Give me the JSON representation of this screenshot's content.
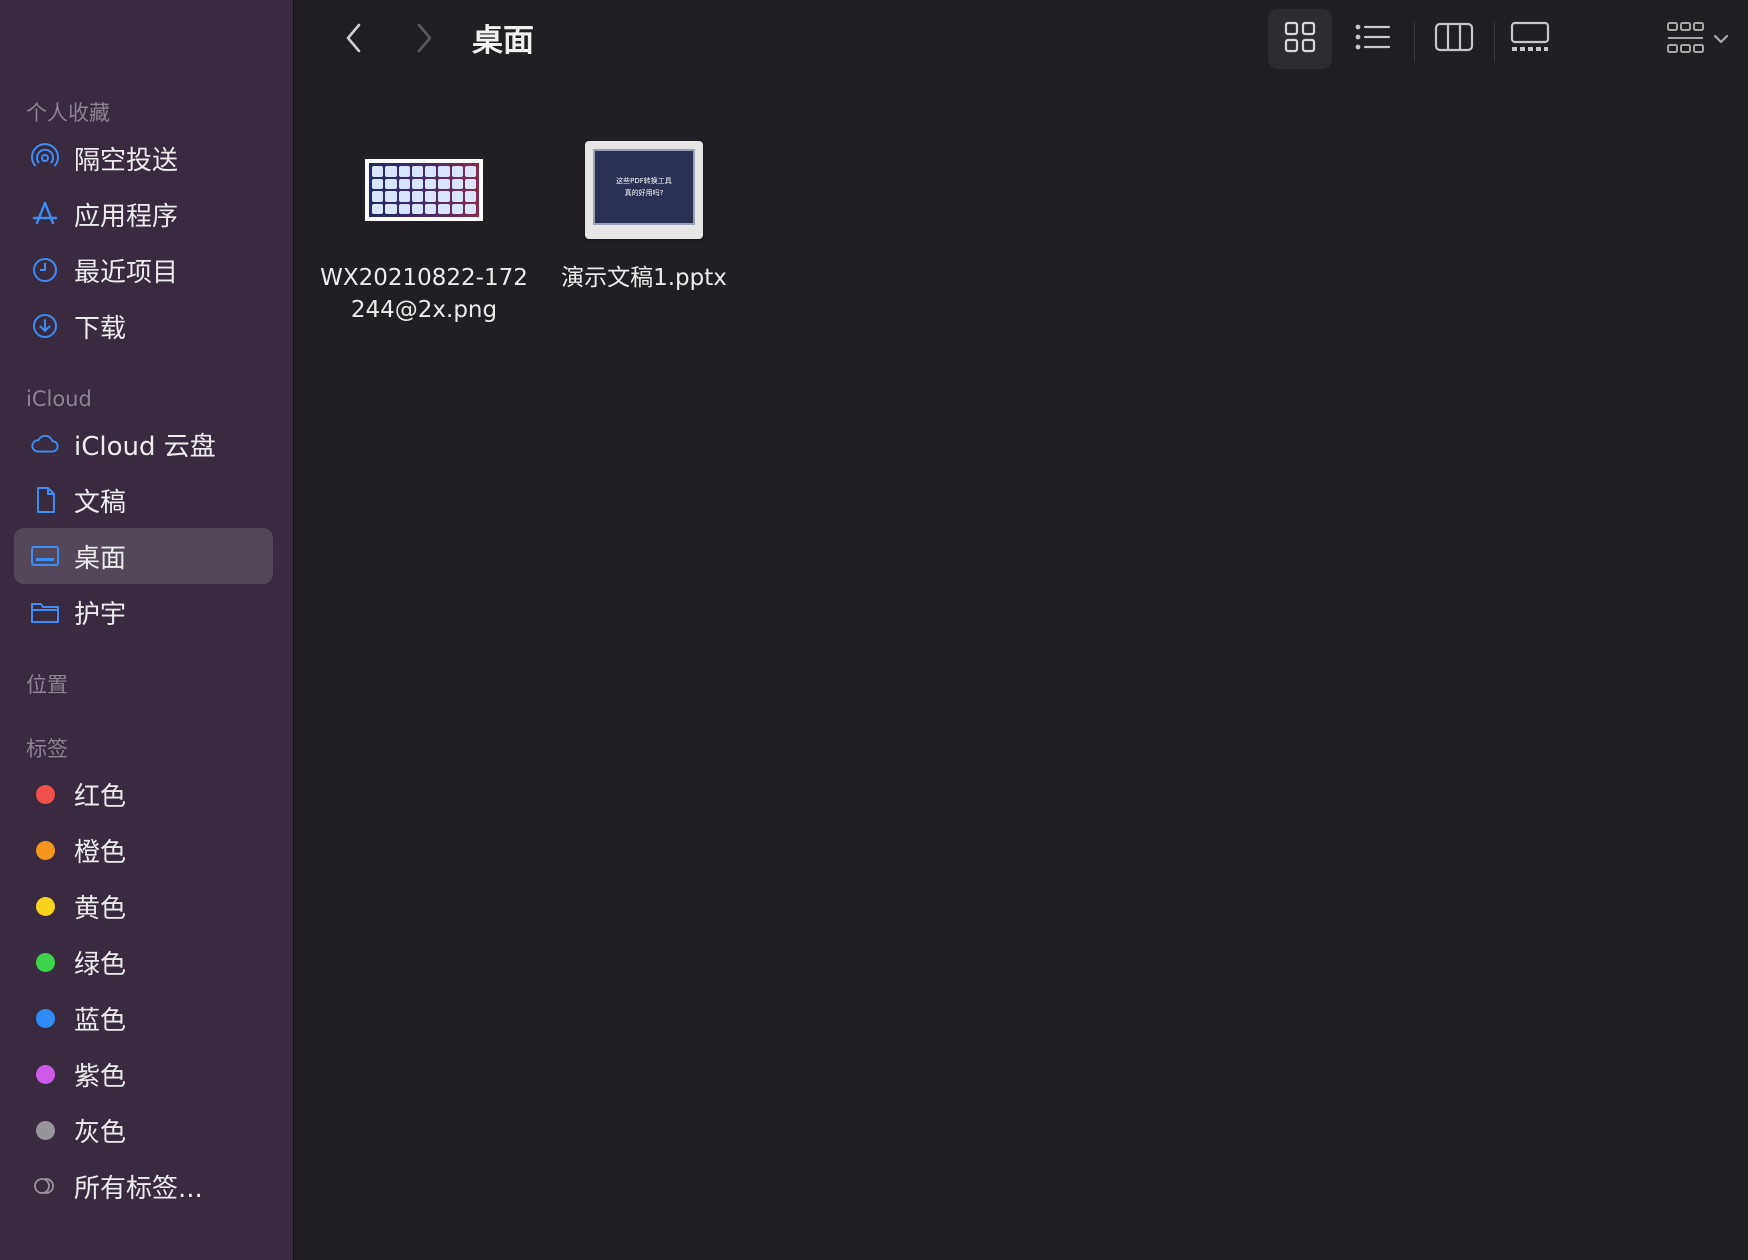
{
  "sidebar": {
    "favorites_title": "个人收藏",
    "favorites": [
      {
        "label": "隔空投送",
        "icon": "airdrop-icon"
      },
      {
        "label": "应用程序",
        "icon": "applications-icon"
      },
      {
        "label": "最近项目",
        "icon": "clock-icon"
      },
      {
        "label": "下载",
        "icon": "download-icon"
      }
    ],
    "icloud_title": "iCloud",
    "icloud": [
      {
        "label": "iCloud 云盘",
        "icon": "cloud-icon"
      },
      {
        "label": "文稿",
        "icon": "document-icon"
      },
      {
        "label": "桌面",
        "icon": "desktop-icon",
        "selected": true
      },
      {
        "label": "护宇",
        "icon": "folder-icon"
      }
    ],
    "locations_title": "位置",
    "tags_title": "标签",
    "tags": [
      {
        "label": "红色",
        "color": "#f2504b"
      },
      {
        "label": "橙色",
        "color": "#f7961e"
      },
      {
        "label": "黄色",
        "color": "#f8d21c"
      },
      {
        "label": "绿色",
        "color": "#3cd44a"
      },
      {
        "label": "蓝色",
        "color": "#2f8cf6"
      },
      {
        "label": "紫色",
        "color": "#cd5be8"
      },
      {
        "label": "灰色",
        "color": "#98949c"
      }
    ],
    "all_tags": {
      "label": "所有标签...",
      "icon": "tags-icon"
    }
  },
  "toolbar": {
    "title": "桌面",
    "back_icon": "chevron-left-icon",
    "forward_icon": "chevron-right-icon",
    "views": [
      "icon-view-icon",
      "list-view-icon",
      "column-view-icon",
      "gallery-view-icon"
    ],
    "group_icon": "group-icon"
  },
  "files": [
    {
      "name": "WX20210822-172244@2x.png",
      "type": "png"
    },
    {
      "name": "演示文稿1.pptx",
      "type": "pptx",
      "slide_lines": [
        "这些PDF转换工具",
        "真的好用吗?"
      ]
    }
  ],
  "colors": {
    "accent": "#3d8df5",
    "sidebar_bg": "#3a2a40",
    "main_bg": "#221f24"
  }
}
